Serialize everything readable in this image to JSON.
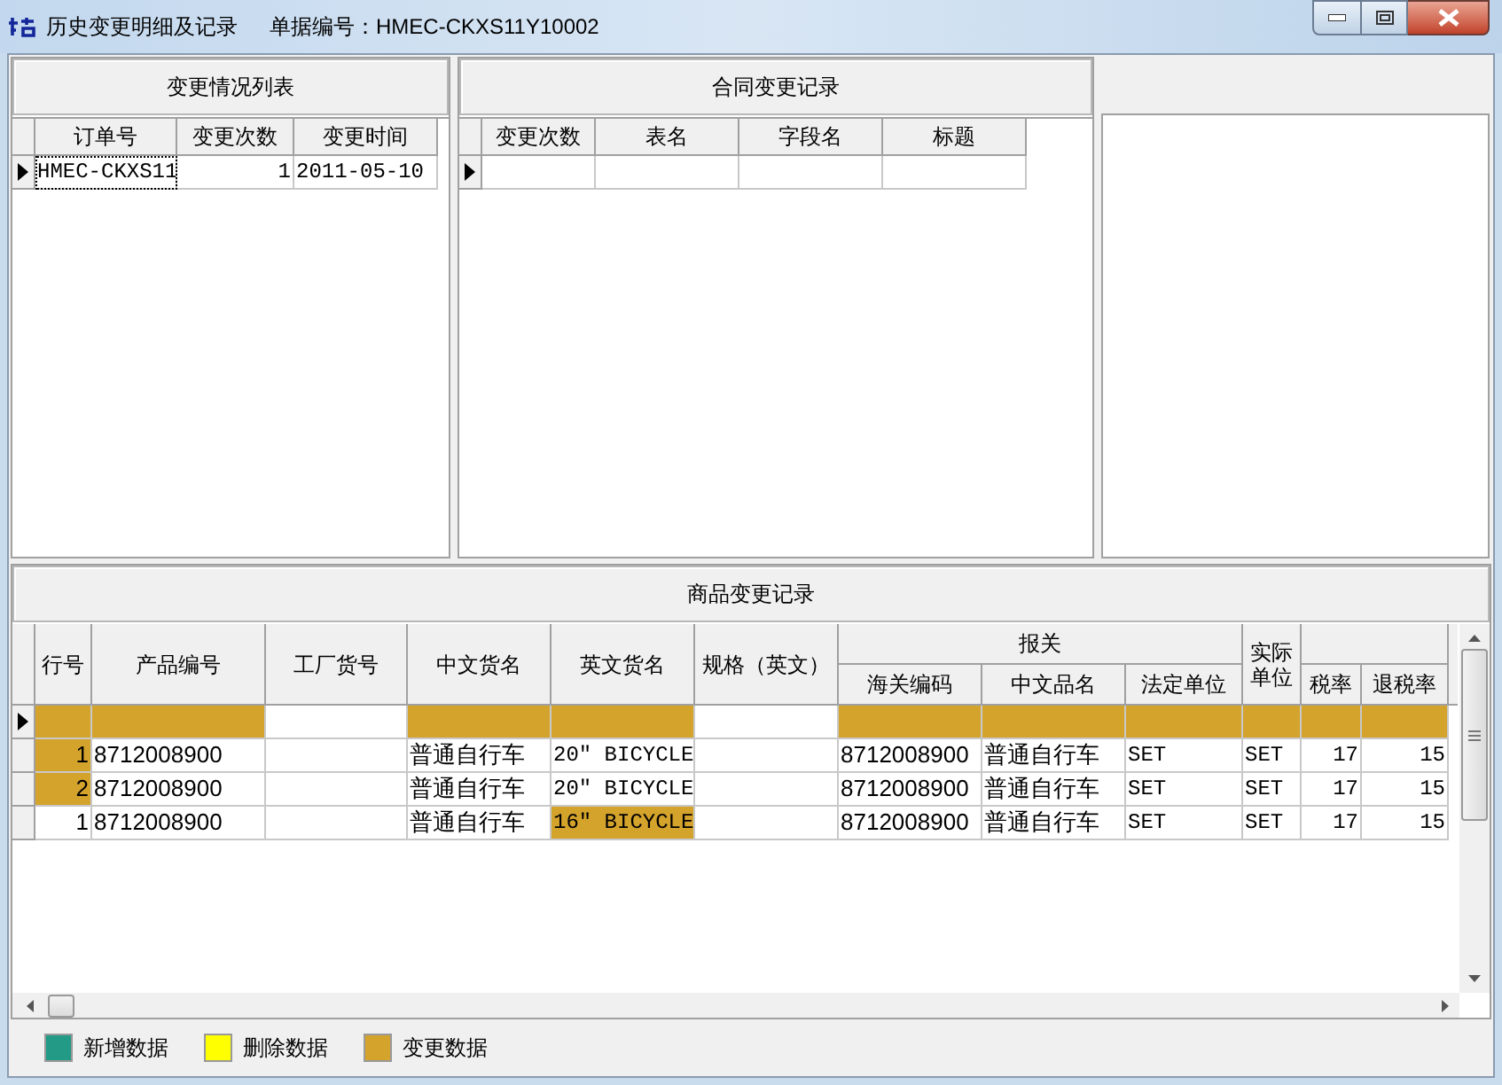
{
  "window": {
    "title": "历史变更明细及记录",
    "document_number": "单据编号：HMEC-CKXS11Y10002"
  },
  "change_list": {
    "title": "变更情况列表",
    "columns": [
      "订单号",
      "变更次数",
      "变更时间"
    ],
    "rows": [
      {
        "current": true,
        "cells": [
          "HMEC-CKXS11",
          "1",
          "2011-05-10"
        ]
      }
    ]
  },
  "contract_changes": {
    "title": "合同变更记录",
    "columns": [
      "变更次数",
      "表名",
      "字段名",
      "标题"
    ],
    "rows": [
      {
        "current": true,
        "cells": []
      }
    ]
  },
  "goods_changes": {
    "title": "商品变更记录",
    "header_groups": [
      {
        "label": "报关"
      }
    ],
    "columns": [
      {
        "kind": "full",
        "label": "行号"
      },
      {
        "kind": "full",
        "label": "产品编号"
      },
      {
        "kind": "full",
        "label": "工厂货号"
      },
      {
        "kind": "full",
        "label": "中文货名"
      },
      {
        "kind": "full",
        "label": "英文货名"
      },
      {
        "kind": "full",
        "label": "规格（英文）"
      },
      {
        "kind": "sub",
        "label": "海关编码"
      },
      {
        "kind": "sub",
        "label": "中文品名"
      },
      {
        "kind": "sub",
        "label": "法定单位"
      },
      {
        "kind": "full",
        "label": "实际单位"
      },
      {
        "kind": "sub",
        "label": "税率"
      },
      {
        "kind": "sub",
        "label": "退税率"
      }
    ],
    "rows": [
      {
        "current": true,
        "cells": [
          {
            "changed": true
          },
          {
            "changed": true
          },
          {
            "changed": false
          },
          {
            "changed": true
          },
          {
            "changed": true
          },
          {
            "changed": false
          },
          {
            "changed": true
          },
          {
            "changed": true
          },
          {
            "changed": true
          },
          {
            "changed": true
          },
          {
            "changed": true
          },
          {
            "changed": true
          }
        ]
      },
      {
        "current": false,
        "cells": [
          {
            "text": "1",
            "changed": true
          },
          {
            "text": "8712008900",
            "changed": false
          },
          {
            "changed": false
          },
          {
            "text": "普通自行车",
            "changed": false
          },
          {
            "text": "20″ BICYCLE",
            "changed": false
          },
          {
            "changed": false
          },
          {
            "text": "8712008900",
            "changed": false
          },
          {
            "text": "普通自行车",
            "changed": false
          },
          {
            "text": "SET",
            "changed": false
          },
          {
            "text": "SET",
            "changed": false
          },
          {
            "text": "17",
            "changed": false
          },
          {
            "text": "15",
            "changed": false
          }
        ]
      },
      {
        "current": false,
        "cells": [
          {
            "text": "2",
            "changed": true
          },
          {
            "text": "8712008900",
            "changed": false
          },
          {
            "changed": false
          },
          {
            "text": "普通自行车",
            "changed": false
          },
          {
            "text": "20″ BICYCLE",
            "changed": false
          },
          {
            "changed": false
          },
          {
            "text": "8712008900",
            "changed": false
          },
          {
            "text": "普通自行车",
            "changed": false
          },
          {
            "text": "SET",
            "changed": false
          },
          {
            "text": "SET",
            "changed": false
          },
          {
            "text": "17",
            "changed": false
          },
          {
            "text": "15",
            "changed": false
          }
        ]
      },
      {
        "current": false,
        "cells": [
          {
            "text": "1",
            "changed": false
          },
          {
            "text": "8712008900",
            "changed": false
          },
          {
            "changed": false
          },
          {
            "text": "普通自行车",
            "changed": false
          },
          {
            "text": "16″ BICYCLE",
            "changed": true
          },
          {
            "changed": false
          },
          {
            "text": "8712008900",
            "changed": false
          },
          {
            "text": "普通自行车",
            "changed": false
          },
          {
            "text": "SET",
            "changed": false
          },
          {
            "text": "SET",
            "changed": false
          },
          {
            "text": "17",
            "changed": false
          },
          {
            "text": "15",
            "changed": false
          }
        ]
      }
    ]
  },
  "legend": [
    {
      "label": "新增数据",
      "color": "#229a85"
    },
    {
      "label": "删除数据",
      "color": "#ffff00"
    },
    {
      "label": "变更数据",
      "color": "#d4a32c"
    }
  ]
}
